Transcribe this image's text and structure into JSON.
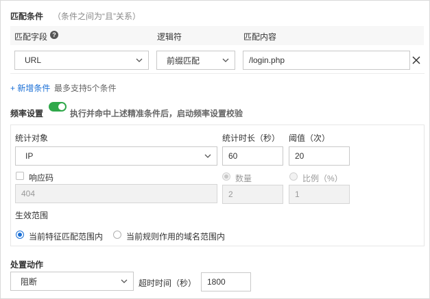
{
  "match": {
    "title": "匹配条件",
    "note": "（条件之间为“且”关系）",
    "headers": {
      "field": "匹配字段",
      "operator": "逻辑符",
      "content": "匹配内容"
    },
    "row": {
      "field": "URL",
      "operator": "前缀匹配",
      "content": "/login.php"
    },
    "add_link": "+ 新增条件",
    "add_hint": "最多支持5个条件"
  },
  "rate": {
    "title": "频率设置",
    "enabled": true,
    "desc": "执行并命中上述精准条件后，启动频率设置校验",
    "stat_object_label": "统计对象",
    "stat_object_value": "IP",
    "duration_label": "统计时长（秒）",
    "duration_value": "60",
    "threshold_label": "阈值（次）",
    "threshold_value": "20",
    "response_code_label": "响应码",
    "response_code_value": "404",
    "count_label": "数量",
    "count_value": "2",
    "ratio_label": "比例（%）",
    "ratio_value": "1",
    "scope_label": "生效范围",
    "scope_option1": "当前特征匹配范围内",
    "scope_option2": "当前规则作用的域名范围内"
  },
  "action": {
    "title": "处置动作",
    "value": "阻断",
    "timeout_label": "超时时间（秒）",
    "timeout_value": "1800"
  },
  "colors": {
    "accent": "#1a6fd6",
    "toggle_on": "#2fa84a"
  }
}
